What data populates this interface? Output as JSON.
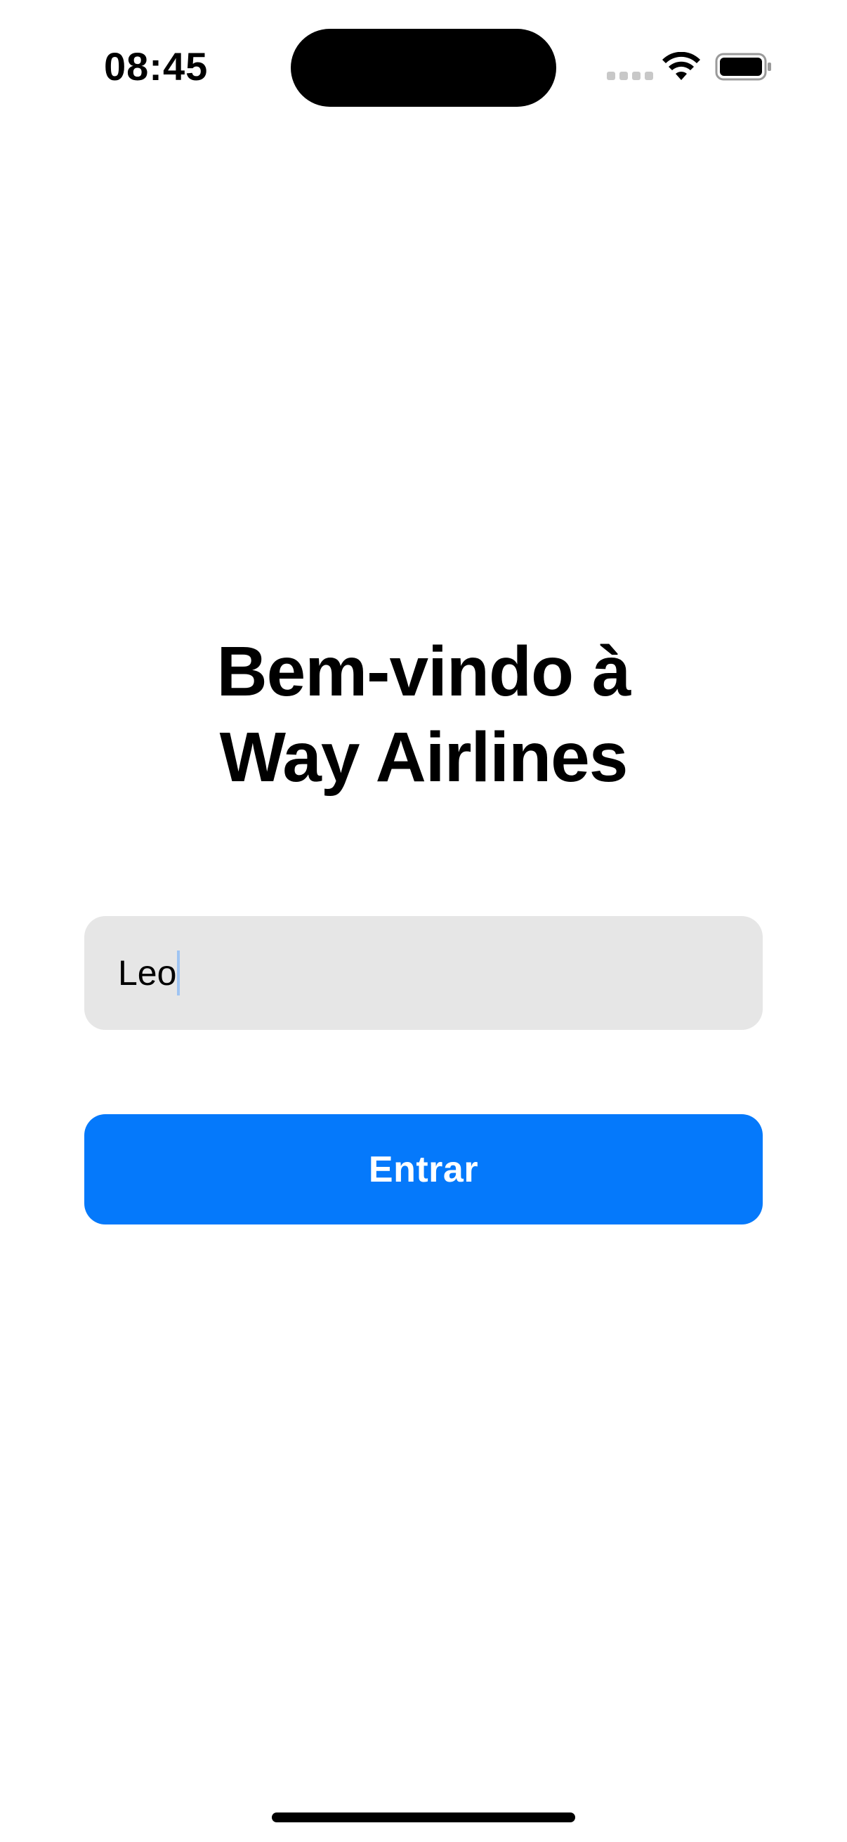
{
  "status_bar": {
    "time": "08:45",
    "icons": [
      "cellular-signal-icon",
      "wifi-icon",
      "battery-icon"
    ]
  },
  "title": {
    "line1": "Bem-vindo à",
    "line2": "Way Airlines"
  },
  "name_input": {
    "value": "Leo"
  },
  "enter_button": {
    "label": "Entrar"
  },
  "colors": {
    "accent": "#0579fb",
    "input_background": "#e6e6e6",
    "caret": "#9fc4f2"
  }
}
